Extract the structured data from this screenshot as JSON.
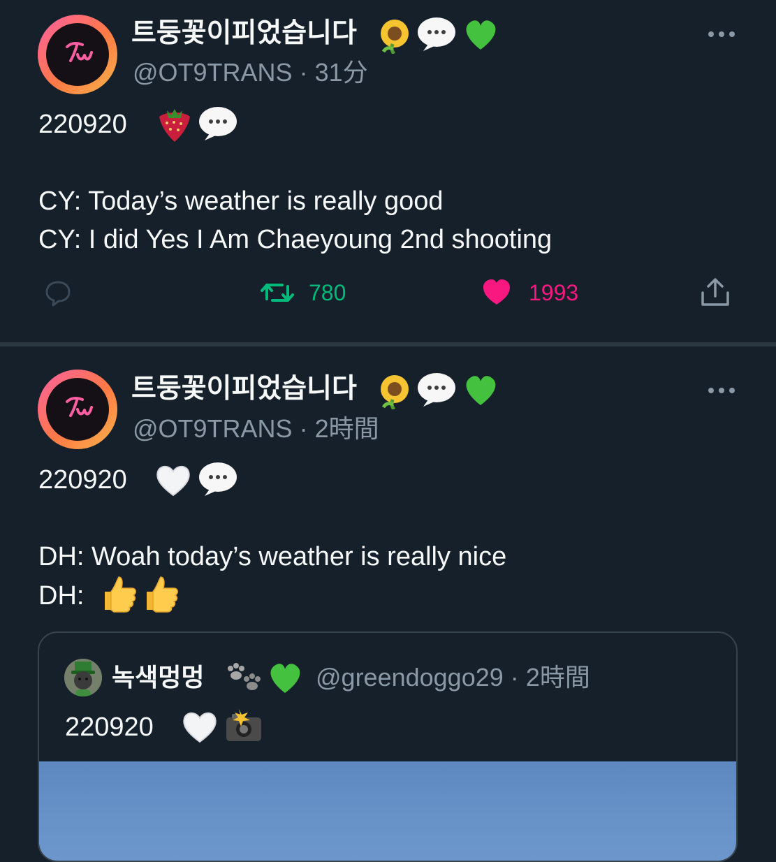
{
  "colors": {
    "background": "#15202b",
    "text_primary": "#f7f9f9",
    "text_secondary": "#8b98a5",
    "retweet_green": "#00ba7c",
    "like_pink": "#f91880",
    "divider": "#38444d"
  },
  "tweets": [
    {
      "author": {
        "display_name": "트둥꽃이피었습니다",
        "name_emojis": [
          "sunflower-emoji",
          "speech-bubble-emoji",
          "green-heart-emoji"
        ],
        "handle": "@OT9TRANS",
        "time": "31分"
      },
      "body": {
        "line1": "220920",
        "line1_emojis": [
          "strawberry-emoji",
          "speech-bubble-emoji"
        ],
        "line2": "CY: Today’s weather is really good",
        "line3": "CY: I did Yes I Am Chaeyoung 2nd shooting"
      },
      "actions": {
        "reply_icon": "reply-icon",
        "retweet_icon": "retweet-icon",
        "retweet_count": "780",
        "like_icon": "heart-icon",
        "like_count": "1993",
        "share_icon": "share-icon"
      },
      "more_icon": "more-icon"
    },
    {
      "author": {
        "display_name": "트둥꽃이피었습니다",
        "name_emojis": [
          "sunflower-emoji",
          "speech-bubble-emoji",
          "green-heart-emoji"
        ],
        "handle": "@OT9TRANS",
        "time": "2時間"
      },
      "body": {
        "line1": "220920",
        "line1_emojis": [
          "white-heart-emoji",
          "speech-bubble-emoji"
        ],
        "line2": "DH: Woah today’s weather is really nice",
        "line3": "DH:",
        "line3_emojis": [
          "thumbs-up-emoji",
          "thumbs-up-emoji"
        ]
      },
      "more_icon": "more-icon",
      "quote": {
        "display_name": "녹색멍멍",
        "name_emojis": [
          "paw-prints-emoji",
          "green-heart-emoji"
        ],
        "handle": "@greendoggo29",
        "time": "2時間",
        "text": "220920",
        "text_emojis": [
          "white-heart-emoji",
          "camera-flash-emoji"
        ],
        "media": "sky-photo"
      }
    }
  ]
}
